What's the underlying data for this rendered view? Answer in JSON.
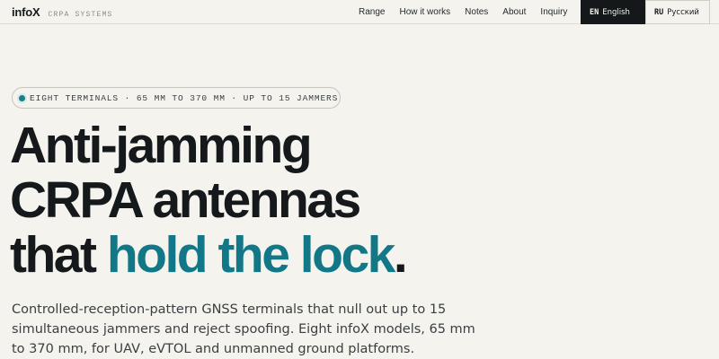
{
  "header": {
    "logo": "infoX",
    "subtitle": "CRPA SYSTEMS",
    "nav": [
      "Range",
      "How it works",
      "Notes",
      "About",
      "Inquiry"
    ],
    "languages": [
      {
        "code": "EN",
        "label": "English",
        "active": true
      },
      {
        "code": "RU",
        "label": "Русский",
        "active": false
      }
    ]
  },
  "hero": {
    "badge": "EIGHT TERMINALS · 65 MM TO 370 MM · UP TO 15 JAMMERS",
    "headline_line1": "Anti-jamming",
    "headline_line2": "CRPA antennas",
    "headline_line3_prefix": "that ",
    "headline_line3_accent": "hold the lock",
    "headline_line3_suffix": ".",
    "lede": "Controlled-reception-pattern GNSS terminals that null out up to 15 simultaneous jammers and reject spoofing. Eight infoX models, 65 mm to 370 mm, for UAV, eVTOL and unmanned ground platforms."
  },
  "colors": {
    "accent": "#127786",
    "background": "#f4f3ee",
    "text": "#15191c"
  }
}
